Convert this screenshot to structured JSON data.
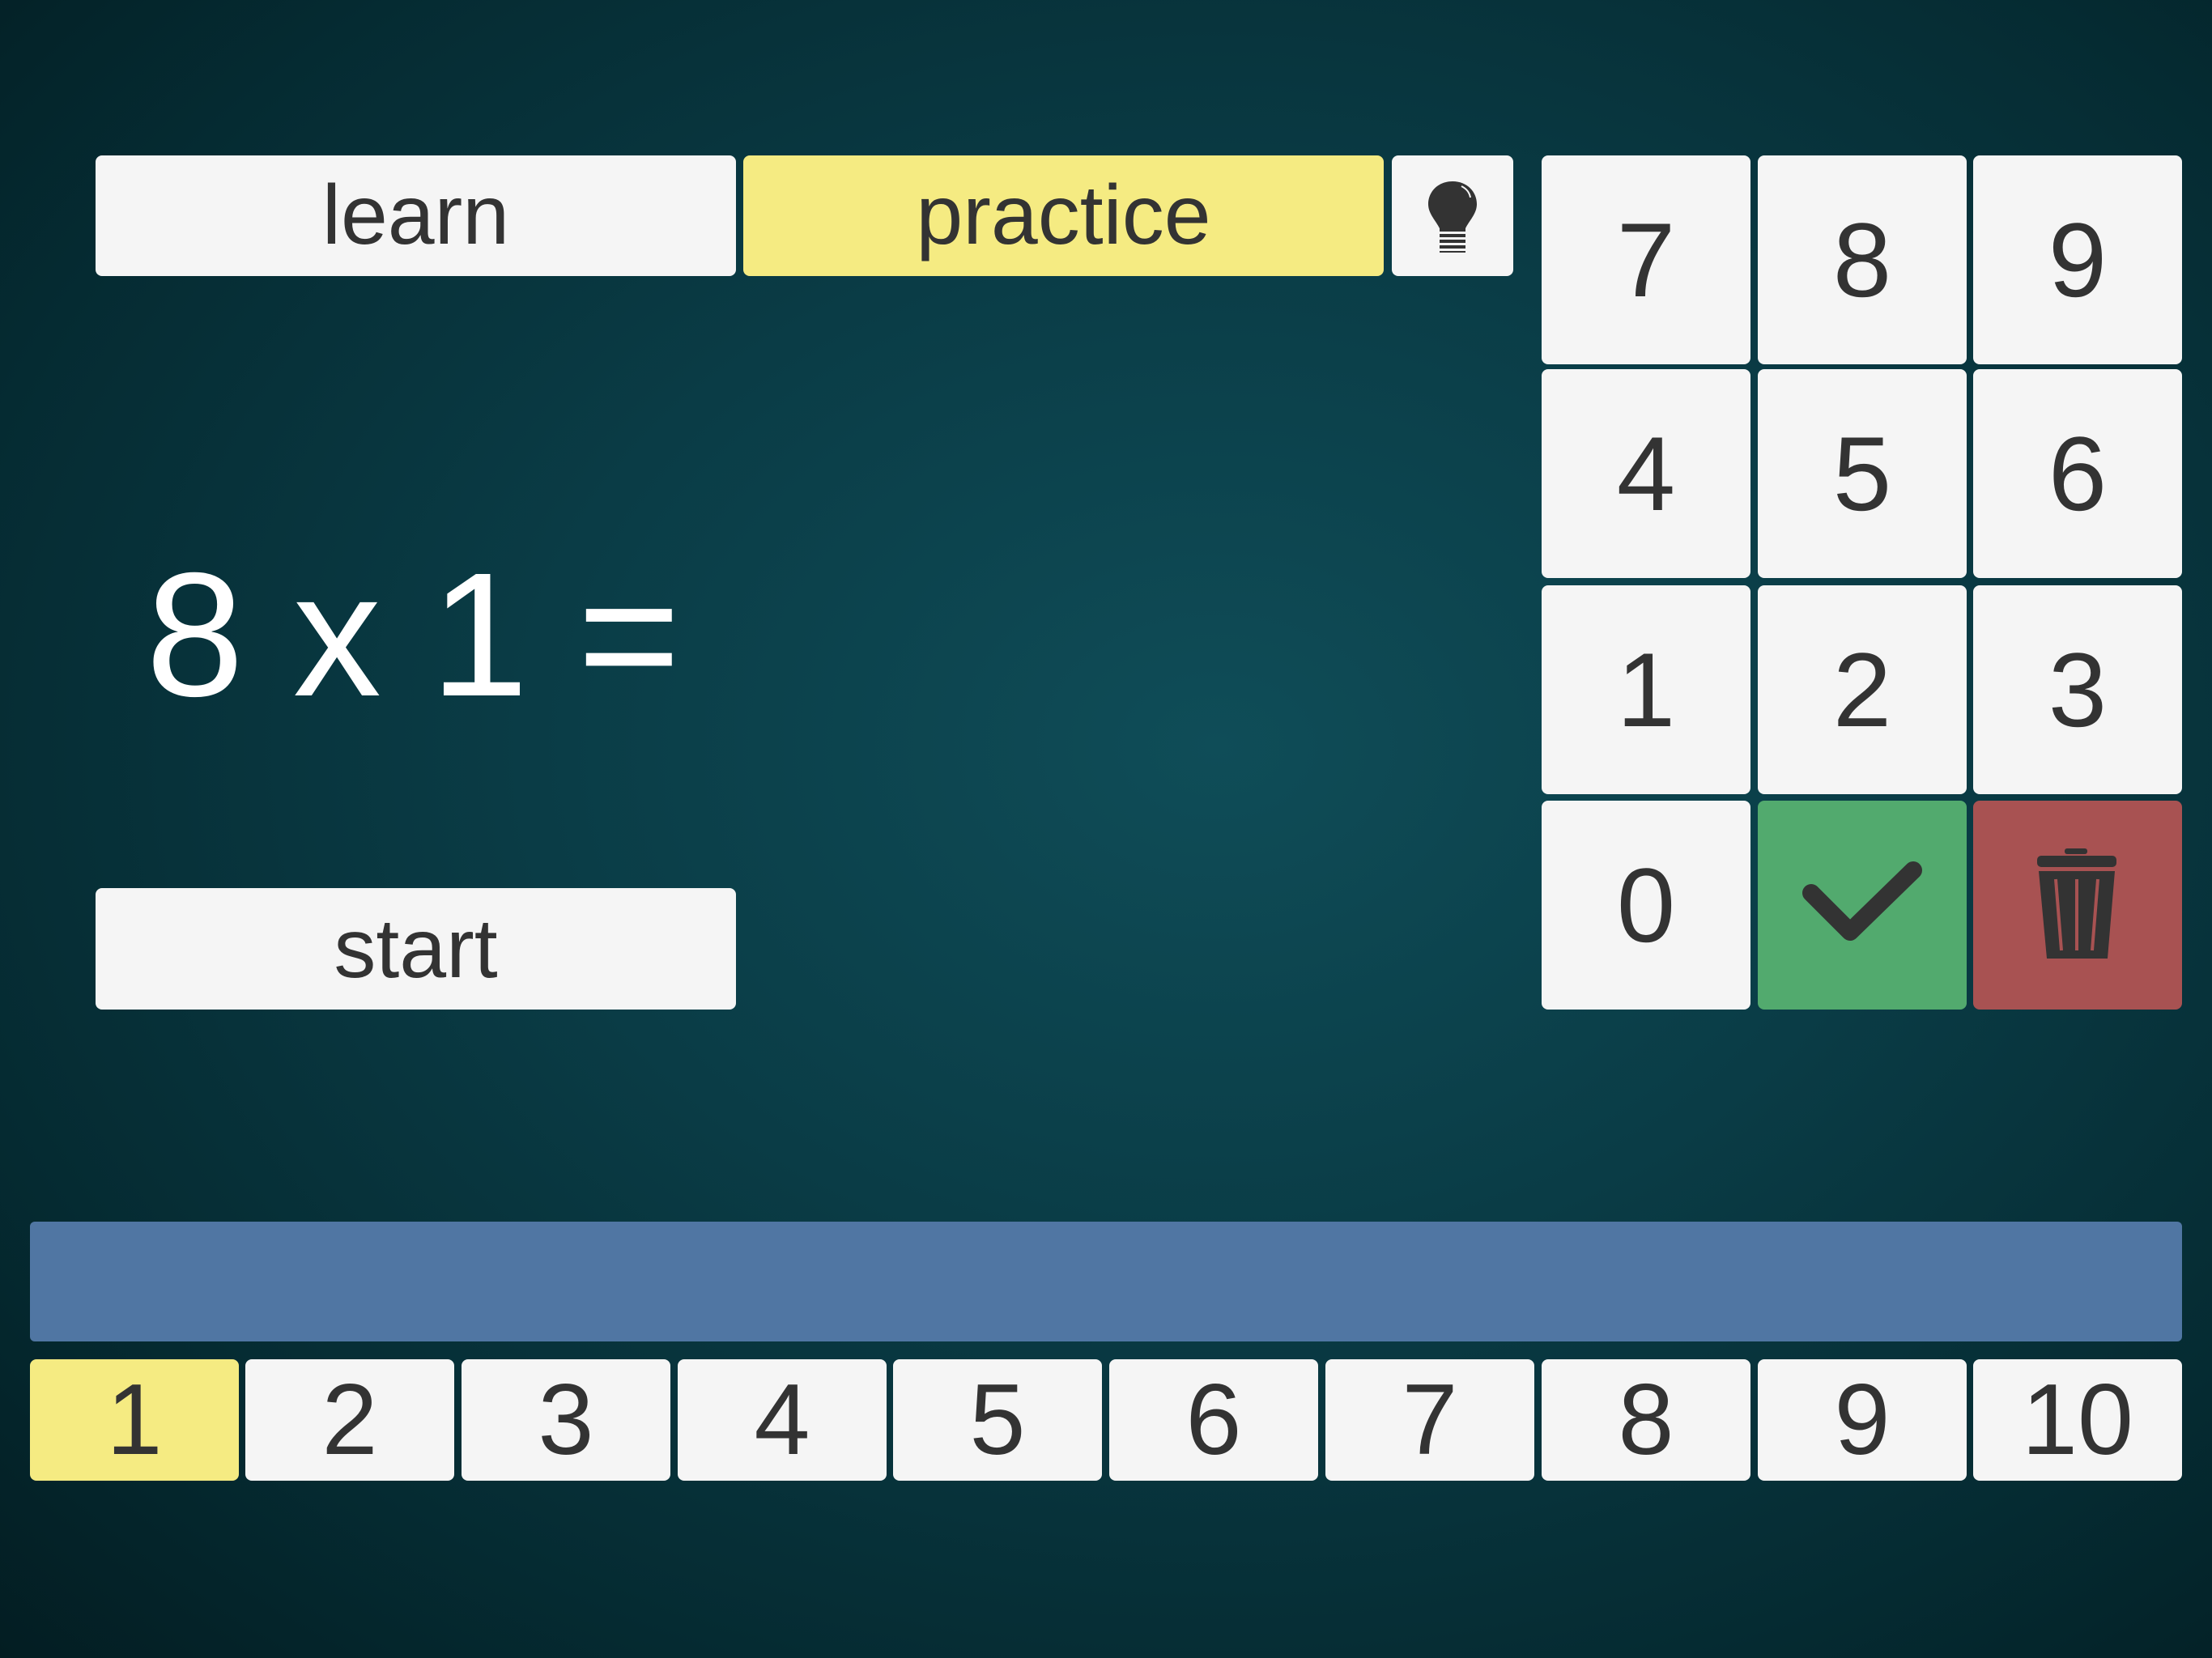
{
  "tabs": {
    "learn": "learn",
    "practice": "practice",
    "active": "practice"
  },
  "hint_icon": "lightbulb-icon",
  "equation": "8 x 1 =",
  "start_label": "start",
  "keypad": {
    "keys": [
      "7",
      "8",
      "9",
      "4",
      "5",
      "6",
      "1",
      "2",
      "3",
      "0"
    ],
    "confirm_icon": "checkmark-icon",
    "delete_icon": "trash-icon"
  },
  "tables": {
    "items": [
      "1",
      "2",
      "3",
      "4",
      "5",
      "6",
      "7",
      "8",
      "9",
      "10"
    ],
    "selected": "1"
  },
  "colors": {
    "selected": "#f5eb82",
    "button": "#f5f5f5",
    "confirm": "#52aa6e",
    "delete": "#a85252",
    "progress": "#5076a3"
  }
}
